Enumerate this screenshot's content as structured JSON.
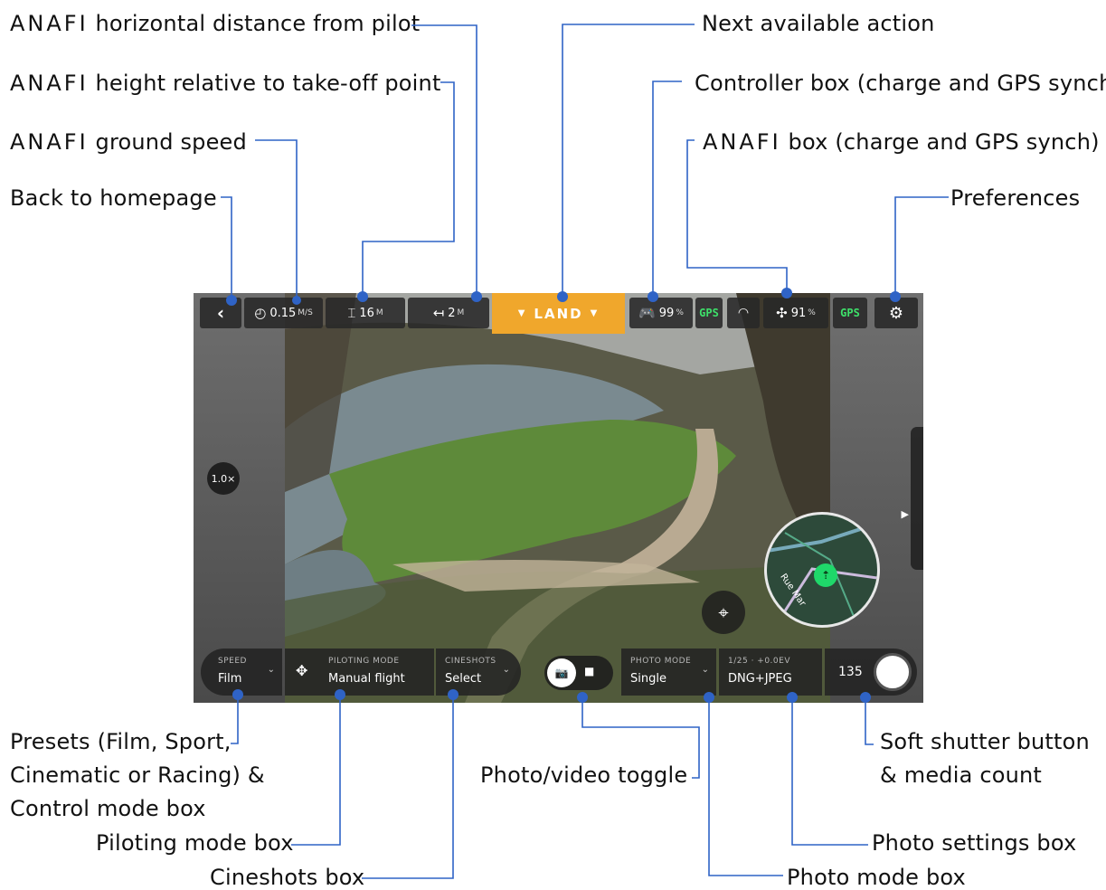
{
  "callouts": {
    "brand": "ANAFI",
    "horizontal_distance": "horizontal distance from pilot",
    "height": "height relative to take-off point",
    "ground_speed": "ground speed",
    "back": "Back to homepage",
    "next_action": "Next available action",
    "controller_box": "Controller box (charge and GPS synch)",
    "anafi_box": "box (charge and GPS synch)",
    "preferences": "Preferences",
    "presets_line1": "Presets (Film, Sport,",
    "presets_line2": "Cinematic or Racing) &",
    "presets_line3": "Control mode box",
    "piloting_mode_box": "Piloting mode box",
    "cineshots_box": "Cineshots box",
    "photo_video_toggle": "Photo/video toggle",
    "shutter_line1": "Soft shutter button",
    "shutter_line2": "& media count",
    "photo_settings_box": "Photo settings box",
    "photo_mode_box": "Photo mode box"
  },
  "topbar": {
    "back_icon": "chevron-left-icon",
    "speed_value": "0.15",
    "speed_unit": "M/S",
    "height_value": "16",
    "height_unit": "M",
    "distance_value": "2",
    "distance_unit": "M",
    "action_label": "LAND",
    "controller_charge": "99",
    "controller_unit": "%",
    "controller_gps": "GPS",
    "drone_charge": "91",
    "drone_unit": "%",
    "drone_gps": "GPS",
    "action_color": "#f0a72c",
    "gps_color": "#3ee06a"
  },
  "zoom_level": "1.0×",
  "minimap": {
    "road_label": "Rue Mar"
  },
  "bottombar": {
    "speed_caption": "SPEED",
    "speed_value": "Film",
    "piloting_caption": "PILOTING MODE",
    "piloting_value": "Manual flight",
    "cineshots_caption": "CINESHOTS",
    "cineshots_value": "Select",
    "photo_mode_caption": "PHOTO MODE",
    "photo_mode_value": "Single",
    "photo_settings_caption": "1/25 · +0.0EV",
    "photo_settings_value": "DNG+JPEG",
    "media_count": "135"
  },
  "colors": {
    "leader": "#2f63c6"
  }
}
